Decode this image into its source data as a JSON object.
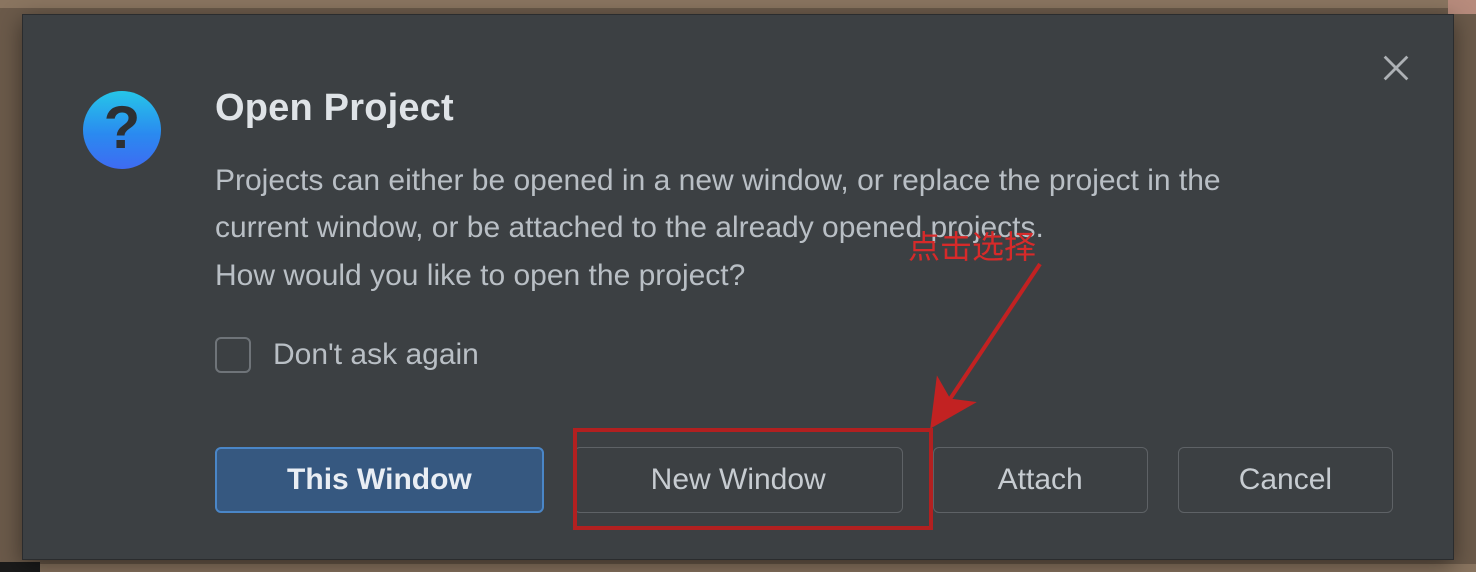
{
  "dialog": {
    "title": "Open Project",
    "body_line1": "Projects can either be opened in a new window, or replace the project in the current window, or be attached to the already opened projects.",
    "body_line2": "How would you like to open the project?",
    "checkbox_label": "Don't ask again",
    "checkbox_checked": false,
    "buttons": {
      "this_window": "This Window",
      "new_window": "New Window",
      "attach": "Attach",
      "cancel": "Cancel"
    }
  },
  "annotation": {
    "label": "点击选择"
  }
}
